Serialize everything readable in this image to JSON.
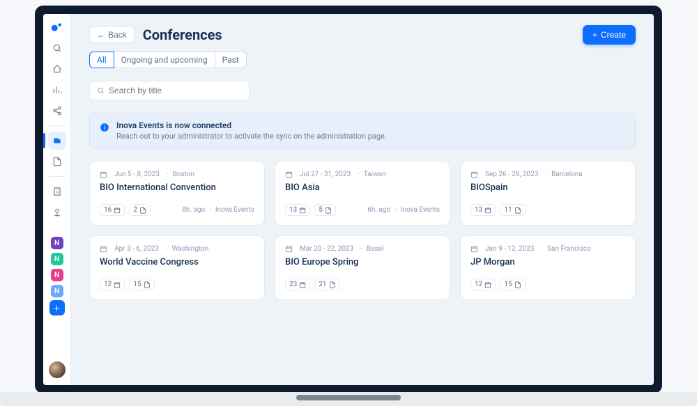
{
  "header": {
    "back_label": "Back",
    "title": "Conferences",
    "create_label": "Create"
  },
  "tabs": [
    "All",
    "Ongoing and upcoming",
    "Past"
  ],
  "search": {
    "placeholder": "Search by title"
  },
  "banner": {
    "title": "Inova Events is now connected",
    "text": "Reach out to your administrator to activate the sync on the administration page."
  },
  "sidebar_tags": [
    {
      "letter": "N",
      "color": "#6f42c1"
    },
    {
      "letter": "N",
      "color": "#20c997"
    },
    {
      "letter": "N",
      "color": "#e83e8c"
    },
    {
      "letter": "N",
      "color": "#6ea8fe"
    }
  ],
  "cards": [
    {
      "date": "Jun 5 -  8, 2023",
      "location": "Boston",
      "title": "BIO International Convention",
      "stat1": "16",
      "stat2": "2",
      "ago": "8h. ago",
      "source": "Inova Events"
    },
    {
      "date": "Jul 27 -  31, 2023",
      "location": "Taiwan",
      "title": "BIO Asia",
      "stat1": "13",
      "stat2": "5",
      "ago": "6h. ago",
      "source": "Inova Events"
    },
    {
      "date": "Sep 26 - 28, 2023",
      "location": "Barcelona",
      "title": "BIOSpain",
      "stat1": "13",
      "stat2": "11",
      "ago": "",
      "source": ""
    },
    {
      "date": "Apr 3 - 6, 2023",
      "location": "Washington",
      "title": "World Vaccine Congress",
      "stat1": "12",
      "stat2": "15",
      "ago": "",
      "source": ""
    },
    {
      "date": "Mar 20 - 22, 2023",
      "location": "Basel",
      "title": "BIO Europe Spring",
      "stat1": "23",
      "stat2": "21",
      "ago": "",
      "source": ""
    },
    {
      "date": "Jan 9 - 12, 2023",
      "location": "San Francisco",
      "title": "JP Morgan",
      "stat1": "12",
      "stat2": "15",
      "ago": "",
      "source": ""
    }
  ]
}
